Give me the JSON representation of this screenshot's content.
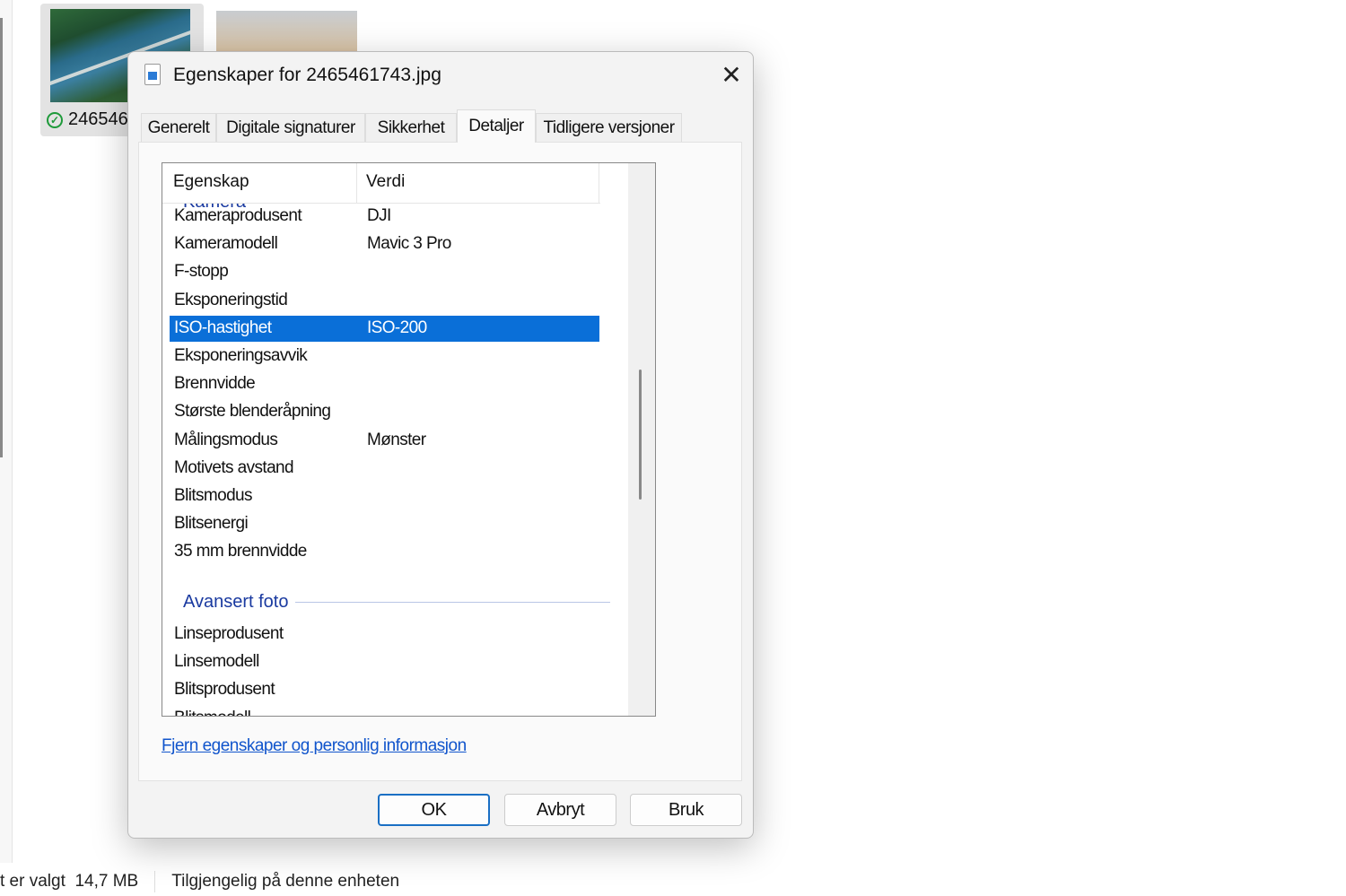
{
  "explorer": {
    "thumb1_caption": "246546",
    "status_selected": "t er valgt",
    "status_size": "14,7 MB",
    "status_availability": "Tilgjengelig på denne enheten"
  },
  "dialog": {
    "title": "Egenskaper for 2465461743.jpg",
    "close": "✕",
    "tabs": [
      "Generelt",
      "Digitale signaturer",
      "Sikkerhet",
      "Detaljer",
      "Tidligere versjoner"
    ],
    "active_tab": "Detaljer",
    "columns": {
      "property": "Egenskap",
      "value": "Verdi"
    },
    "groups": {
      "camera": "Kamera",
      "advanced": "Avansert foto"
    },
    "camera_rows": [
      {
        "p": "Kameraprodusent",
        "v": "DJI"
      },
      {
        "p": "Kameramodell",
        "v": "Mavic 3 Pro"
      },
      {
        "p": "F-stopp",
        "v": ""
      },
      {
        "p": "Eksponeringstid",
        "v": ""
      },
      {
        "p": "ISO-hastighet",
        "v": "ISO-200"
      },
      {
        "p": "Eksponeringsavvik",
        "v": ""
      },
      {
        "p": "Brennvidde",
        "v": ""
      },
      {
        "p": "Største blenderåpning",
        "v": ""
      },
      {
        "p": "Målingsmodus",
        "v": "Mønster"
      },
      {
        "p": "Motivets avstand",
        "v": ""
      },
      {
        "p": "Blitsmodus",
        "v": ""
      },
      {
        "p": "Blitsenergi",
        "v": ""
      },
      {
        "p": "35 mm brennvidde",
        "v": ""
      }
    ],
    "advanced_rows": [
      {
        "p": "Linseprodusent",
        "v": ""
      },
      {
        "p": "Linsemodell",
        "v": ""
      },
      {
        "p": "Blitsprodusent",
        "v": ""
      },
      {
        "p": "Blitsmodell",
        "v": ""
      }
    ],
    "remove_link": "Fjern egenskaper og personlig informasjon",
    "buttons": {
      "ok": "OK",
      "cancel": "Avbryt",
      "apply": "Bruk"
    }
  }
}
